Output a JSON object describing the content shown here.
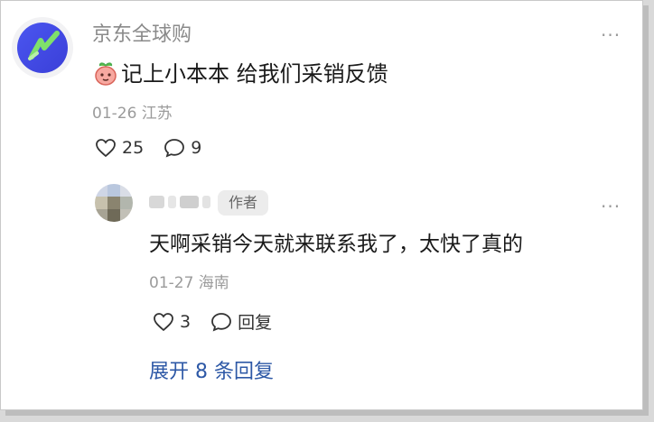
{
  "main_comment": {
    "user_name": "京东全球购",
    "text": "记上小本本 给我们采销反馈",
    "date_location": "01-26 江苏",
    "likes": "25",
    "comments": "9",
    "more_label": "···",
    "emoji_icon": "peach-face-emoji"
  },
  "reply": {
    "author_badge": "作者",
    "text": "天啊采销今天就来联系我了，太快了真的",
    "date_location": "01-27 海南",
    "likes": "3",
    "reply_label": "回复",
    "more_label": "···"
  },
  "expand_label": "展开 8 条回复",
  "colors": {
    "avatar_blue": "#4b56f0",
    "avatar_check": "#7fe06b",
    "link_blue": "#2d58a6"
  }
}
